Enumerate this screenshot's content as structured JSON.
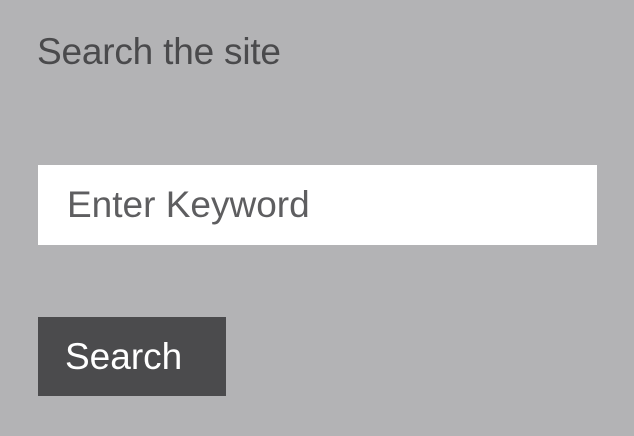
{
  "search_widget": {
    "heading": "Search the site",
    "input": {
      "value": "",
      "placeholder": "Enter Keyword"
    },
    "button_label": "Search"
  },
  "colors": {
    "background": "#b3b3b5",
    "heading_text": "#4a4a4c",
    "input_background": "#ffffff",
    "placeholder_text": "#5e5e60",
    "button_background": "#4b4b4d",
    "button_text": "#ffffff"
  }
}
